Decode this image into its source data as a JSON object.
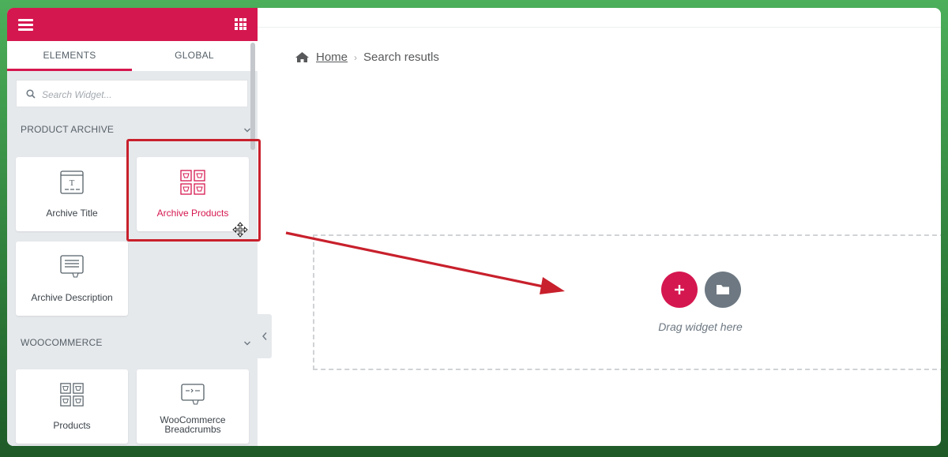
{
  "sidebar": {
    "tabs": [
      {
        "label": "ELEMENTS",
        "active": true
      },
      {
        "label": "GLOBAL",
        "active": false
      }
    ],
    "search": {
      "placeholder": "Search Widget..."
    },
    "categories": [
      {
        "label": "PRODUCT ARCHIVE",
        "widgets": [
          {
            "label": "Archive Title",
            "icon": "archive-title-icon"
          },
          {
            "label": "Archive Products",
            "icon": "archive-products-icon",
            "highlighted": true
          },
          {
            "label": "Archive Description",
            "icon": "archive-description-icon"
          }
        ]
      },
      {
        "label": "WOOCOMMERCE",
        "widgets": [
          {
            "label": "Products",
            "icon": "products-icon"
          },
          {
            "label": "WooCommerce Breadcrumbs",
            "icon": "woocommerce-breadcrumbs-icon"
          }
        ]
      }
    ]
  },
  "canvas": {
    "breadcrumb": {
      "home": "Home",
      "current": "Search resutls"
    },
    "dropzone": {
      "text": "Drag widget here"
    }
  },
  "colors": {
    "accent": "#d5174f",
    "highlight": "#c8202c",
    "folder_button": "#6d7882"
  }
}
